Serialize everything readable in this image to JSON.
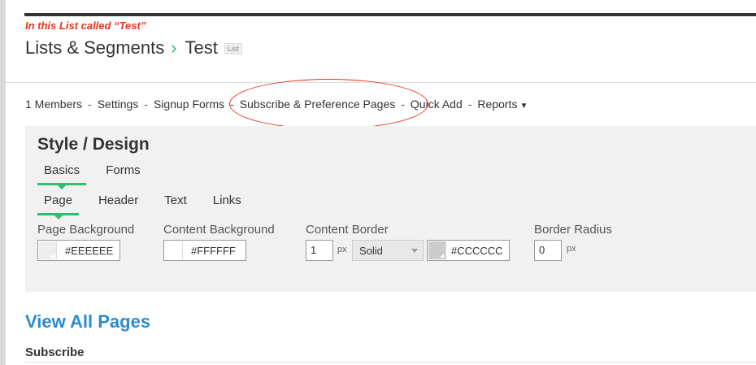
{
  "annotation": "In this List called “Test”",
  "breadcrumb": {
    "parent": "Lists & Segments",
    "current": "Test",
    "badge": "List"
  },
  "subnav": {
    "items": [
      "1 Members",
      "Settings",
      "Signup Forms",
      "Subscribe & Preference Pages",
      "Quick Add",
      "Reports"
    ]
  },
  "style_design": {
    "title": "Style / Design",
    "tabs": [
      "Basics",
      "Forms"
    ],
    "subtabs": [
      "Page",
      "Header",
      "Text",
      "Links"
    ],
    "page_background": {
      "label": "Page Background",
      "value": "#EEEEEE",
      "color": "#EEEEEE"
    },
    "content_background": {
      "label": "Content Background",
      "value": "#FFFFFF",
      "color": "#FFFFFF"
    },
    "content_border": {
      "label": "Content Border",
      "width": "1",
      "unit": "px",
      "style": "Solid",
      "value": "#CCCCCC",
      "color": "#CCCCCC"
    },
    "border_radius": {
      "label": "Border Radius",
      "value": "0",
      "unit": "px"
    }
  },
  "view_all": "View All Pages",
  "subscribe_heading": "Subscribe",
  "colors": {
    "accent_green": "#2bbf6f",
    "link_blue": "#2b8ccc",
    "annotation_red": "#e2301b"
  }
}
